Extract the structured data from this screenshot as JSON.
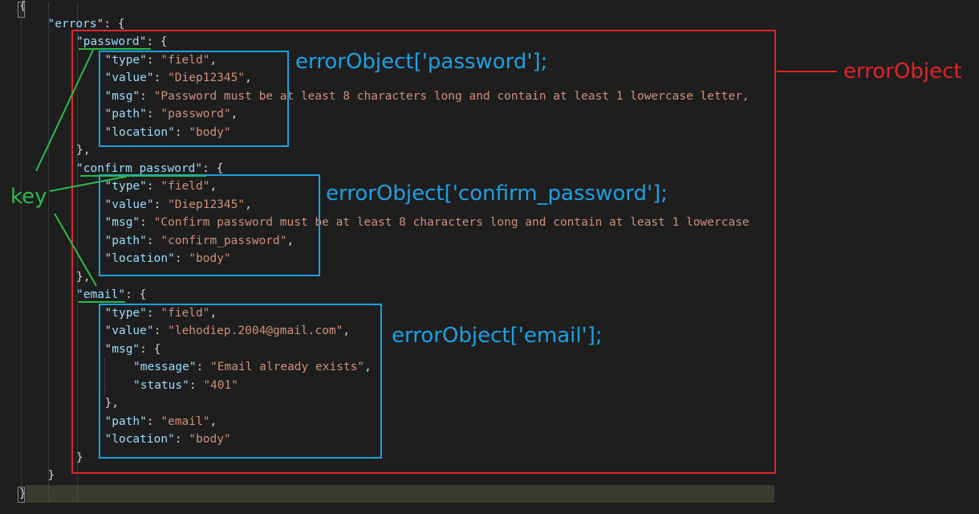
{
  "code": {
    "lines": [
      [
        {
          "t": "pun",
          "v": "{"
        }
      ],
      [
        {
          "t": "key",
          "v": "\"errors\""
        },
        {
          "t": "pun",
          "v": ": {"
        }
      ],
      [
        {
          "t": "key",
          "v": "\"password\""
        },
        {
          "t": "pun",
          "v": ": {"
        }
      ],
      [
        {
          "t": "key",
          "v": "\"type\""
        },
        {
          "t": "pun",
          "v": ": "
        },
        {
          "t": "str",
          "v": "\"field\""
        },
        {
          "t": "pun",
          "v": ","
        }
      ],
      [
        {
          "t": "key",
          "v": "\"value\""
        },
        {
          "t": "pun",
          "v": ": "
        },
        {
          "t": "str",
          "v": "\"Diep12345\""
        },
        {
          "t": "pun",
          "v": ","
        }
      ],
      [
        {
          "t": "key",
          "v": "\"msg\""
        },
        {
          "t": "pun",
          "v": ": "
        },
        {
          "t": "str",
          "v": "\"Password must be at least 8 characters long and contain at least 1 lowercase letter,"
        }
      ],
      [
        {
          "t": "key",
          "v": "\"path\""
        },
        {
          "t": "pun",
          "v": ": "
        },
        {
          "t": "str",
          "v": "\"password\""
        },
        {
          "t": "pun",
          "v": ","
        }
      ],
      [
        {
          "t": "key",
          "v": "\"location\""
        },
        {
          "t": "pun",
          "v": ": "
        },
        {
          "t": "str",
          "v": "\"body\""
        }
      ],
      [
        {
          "t": "pun",
          "v": "},"
        }
      ],
      [
        {
          "t": "key",
          "v": "\"confirm_password\""
        },
        {
          "t": "pun",
          "v": ": {"
        }
      ],
      [
        {
          "t": "key",
          "v": "\"type\""
        },
        {
          "t": "pun",
          "v": ": "
        },
        {
          "t": "str",
          "v": "\"field\""
        },
        {
          "t": "pun",
          "v": ","
        }
      ],
      [
        {
          "t": "key",
          "v": "\"value\""
        },
        {
          "t": "pun",
          "v": ": "
        },
        {
          "t": "str",
          "v": "\"Diep12345\""
        },
        {
          "t": "pun",
          "v": ","
        }
      ],
      [
        {
          "t": "key",
          "v": "\"msg\""
        },
        {
          "t": "pun",
          "v": ": "
        },
        {
          "t": "str",
          "v": "\"Confirm password must be at least 8 characters long and contain at least 1 lowercase"
        }
      ],
      [
        {
          "t": "key",
          "v": "\"path\""
        },
        {
          "t": "pun",
          "v": ": "
        },
        {
          "t": "str",
          "v": "\"confirm_password\""
        },
        {
          "t": "pun",
          "v": ","
        }
      ],
      [
        {
          "t": "key",
          "v": "\"location\""
        },
        {
          "t": "pun",
          "v": ": "
        },
        {
          "t": "str",
          "v": "\"body\""
        }
      ],
      [
        {
          "t": "pun",
          "v": "},"
        }
      ],
      [
        {
          "t": "key",
          "v": "\"email\""
        },
        {
          "t": "pun",
          "v": ": {"
        }
      ],
      [
        {
          "t": "key",
          "v": "\"type\""
        },
        {
          "t": "pun",
          "v": ": "
        },
        {
          "t": "str",
          "v": "\"field\""
        },
        {
          "t": "pun",
          "v": ","
        }
      ],
      [
        {
          "t": "key",
          "v": "\"value\""
        },
        {
          "t": "pun",
          "v": ": "
        },
        {
          "t": "str",
          "v": "\"lehodiep.2004@gmail.com\""
        },
        {
          "t": "pun",
          "v": ","
        }
      ],
      [
        {
          "t": "key",
          "v": "\"msg\""
        },
        {
          "t": "pun",
          "v": ": {"
        }
      ],
      [
        {
          "t": "key",
          "v": "\"message\""
        },
        {
          "t": "pun",
          "v": ": "
        },
        {
          "t": "str",
          "v": "\"Email already exists\""
        },
        {
          "t": "pun",
          "v": ","
        }
      ],
      [
        {
          "t": "key",
          "v": "\"status\""
        },
        {
          "t": "pun",
          "v": ": "
        },
        {
          "t": "str",
          "v": "\"401\""
        }
      ],
      [
        {
          "t": "pun",
          "v": "},"
        }
      ],
      [
        {
          "t": "key",
          "v": "\"path\""
        },
        {
          "t": "pun",
          "v": ": "
        },
        {
          "t": "str",
          "v": "\"email\""
        },
        {
          "t": "pun",
          "v": ","
        }
      ],
      [
        {
          "t": "key",
          "v": "\"location\""
        },
        {
          "t": "pun",
          "v": ": "
        },
        {
          "t": "str",
          "v": "\"body\""
        }
      ],
      [
        {
          "t": "pun",
          "v": "}"
        }
      ],
      [
        {
          "t": "pun",
          "v": "}"
        }
      ],
      [
        {
          "t": "pun",
          "v": "}"
        }
      ]
    ]
  },
  "annotations": {
    "error_object_label": "errorObject",
    "password_label": "errorObject['password'];",
    "confirm_password_label": "errorObject['confirm_password'];",
    "email_label": "errorObject['email'];",
    "key_label": "key"
  },
  "colors": {
    "red": "#e0242b",
    "blue": "#1ba1e2",
    "green": "#2dbb4a",
    "editor_bg": "#1e1e1e",
    "json_key": "#9cdcfe",
    "json_string": "#ce9178"
  }
}
